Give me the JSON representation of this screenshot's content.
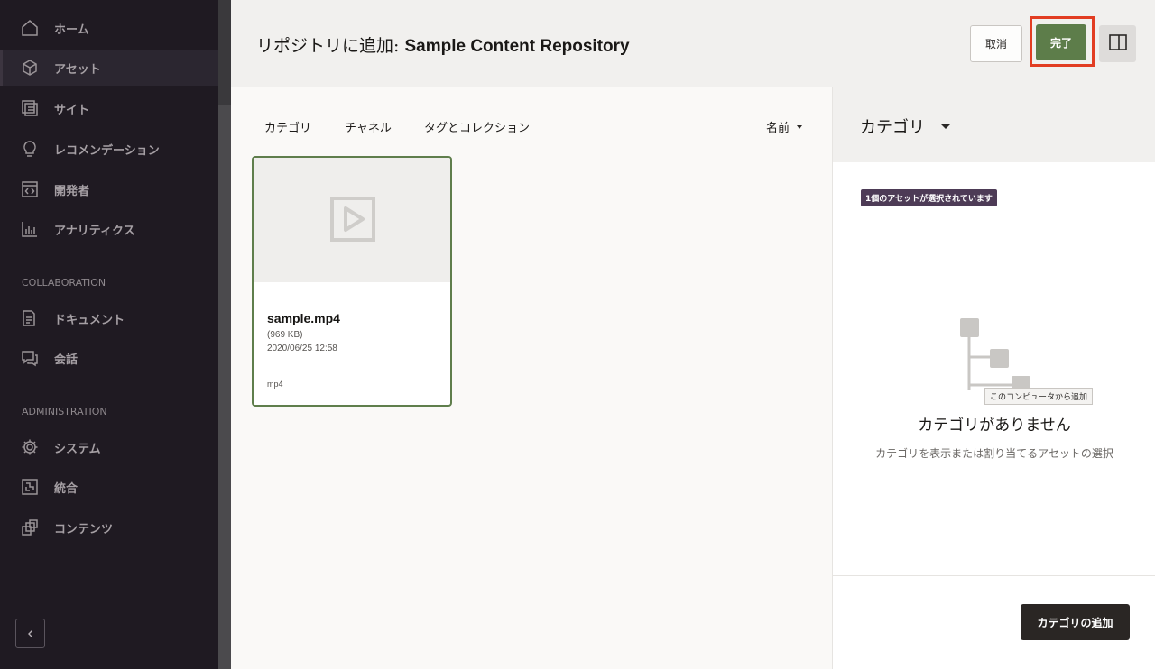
{
  "sidebar": {
    "items": [
      {
        "label": "ホーム",
        "icon": "home-icon"
      },
      {
        "label": "アセット",
        "icon": "cube-icon"
      },
      {
        "label": "サイト",
        "icon": "site-icon"
      },
      {
        "label": "レコメンデーション",
        "icon": "lightbulb-icon"
      },
      {
        "label": "開発者",
        "icon": "code-icon"
      },
      {
        "label": "アナリティクス",
        "icon": "bar-chart-icon"
      }
    ],
    "collaboration_heading": "COLLABORATION",
    "collaboration_items": [
      {
        "label": "ドキュメント",
        "icon": "documents-icon"
      },
      {
        "label": "会話",
        "icon": "conversation-icon"
      }
    ],
    "administration_heading": "ADMINISTRATION",
    "administration_items": [
      {
        "label": "システム",
        "icon": "gear-icon"
      },
      {
        "label": "統合",
        "icon": "integration-icon"
      },
      {
        "label": "コンテンツ",
        "icon": "content-icon"
      }
    ],
    "collapse_icon": "chevron-left-icon"
  },
  "header": {
    "title_prefix": "リポジトリに追加:",
    "title_repo": "Sample Content Repository",
    "cancel_label": "取消",
    "done_label": "完了",
    "panel_toggle_icon": "panel-toggle-icon"
  },
  "tabs": [
    "カテゴリ",
    "チャネル",
    "タグとコレクション"
  ],
  "sort_label": "名前",
  "asset": {
    "name": "sample.mp4",
    "size": "(969 KB)",
    "date": "2020/06/25 12:58",
    "type": "mp4",
    "icon": "video-play-icon"
  },
  "panel": {
    "title": "カテゴリ",
    "selection_badge": "1個のアセットが選択されています",
    "tooltip": "このコンピュータから追加",
    "empty_title": "カテゴリがありません",
    "empty_description": "カテゴリを表示または割り当てるアセットの選択",
    "add_button_label": "カテゴリの追加"
  },
  "colors": {
    "accent_green": "#5d7d4a",
    "highlight_red": "#e23d22",
    "badge_purple": "#4d3b56"
  }
}
